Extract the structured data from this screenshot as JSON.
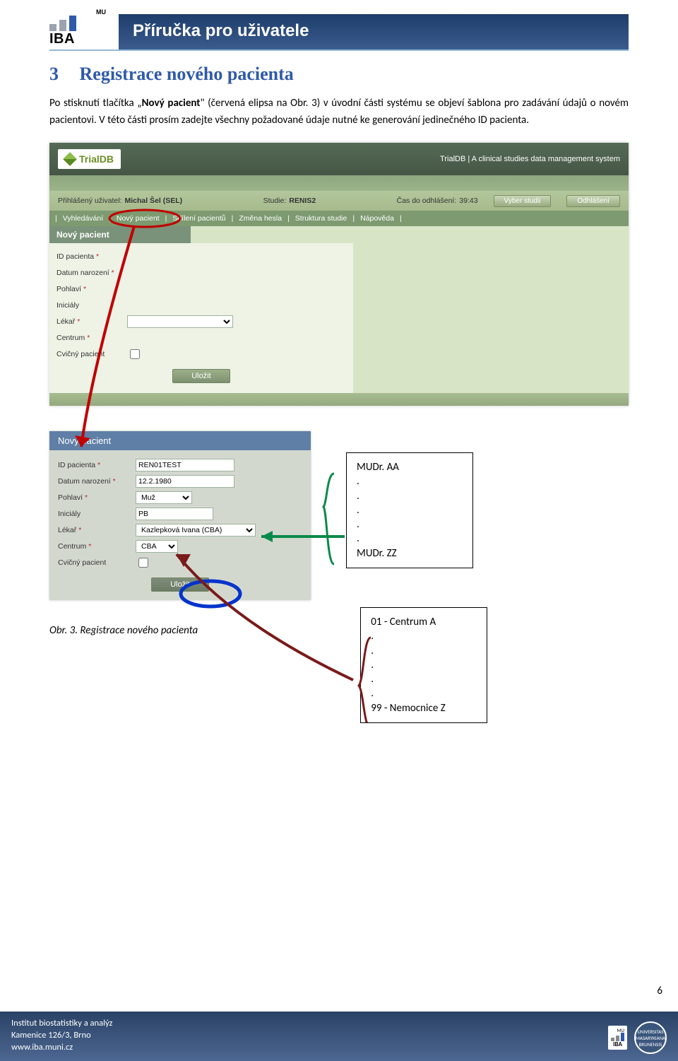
{
  "header": {
    "mu": "MU",
    "iba": "IBA",
    "title": "Příručka pro uživatele"
  },
  "section": {
    "number": "3",
    "title": "Registrace nového pacienta"
  },
  "paragraph": {
    "p1a": "Po stisknutí tlačítka „",
    "p1b": "Nový pacient",
    "p1c": "\" (červená elipsa na Obr. 3) v úvodní části systému se objeví šablona pro zadávání údajů o novém pacientovi. V této části prosím zadejte všechny požadované údaje nutné ke generování jedinečného ID pacienta."
  },
  "shot1": {
    "logo": "TrialDB",
    "tagline": "TrialDB | A clinical studies data management system",
    "info_user_label": "Přihlášený uživatel:",
    "info_user_value": "Michal Šel (SEL)",
    "info_study_label": "Studie:",
    "info_study_value": "RENIS2",
    "info_time_label": "Čas do odhlášení:",
    "info_time_value": "39:43",
    "btn_select": "Vyber studii",
    "btn_logout": "Odhlášení",
    "nav": [
      "Vyhledávání",
      "Nový pacient",
      "Sdílení pacientů",
      "Změna hesla",
      "Struktura studie",
      "Nápověda"
    ],
    "panel_title": "Nový pacient",
    "labels": {
      "id": "ID pacienta",
      "dob": "Datum narození",
      "sex": "Pohlaví",
      "initials": "Iniciály",
      "doctor": "Lékař",
      "center": "Centrum",
      "training": "Cvičný pacient"
    },
    "save": "Uložit"
  },
  "shot2": {
    "panel_title": "Nový pacient",
    "values": {
      "id": "REN01TEST",
      "dob": "12.2.1980",
      "sex": "Muž",
      "initials": "PB",
      "doctor": "Kazlepková Ivana (CBA)",
      "center": "CBA"
    },
    "save": "Uložit"
  },
  "callout_doctors": {
    "first": "MUDr. AA",
    "dots": ".",
    "last": "MUDr. ZZ"
  },
  "callout_centers": {
    "first": "01 - Centrum A",
    "dots": ".",
    "last": "99 - Nemocnice Z"
  },
  "caption": "Obr. 3. Registrace nového pacienta",
  "footer": {
    "l1": "Institut biostatistiky a analýz",
    "l2": "Kamenice 126/3, Brno",
    "l3": "www.iba.muni.cz",
    "page": "6",
    "seal": "UNIVERSITAS MASARYKIANA BRUNENSIS"
  }
}
